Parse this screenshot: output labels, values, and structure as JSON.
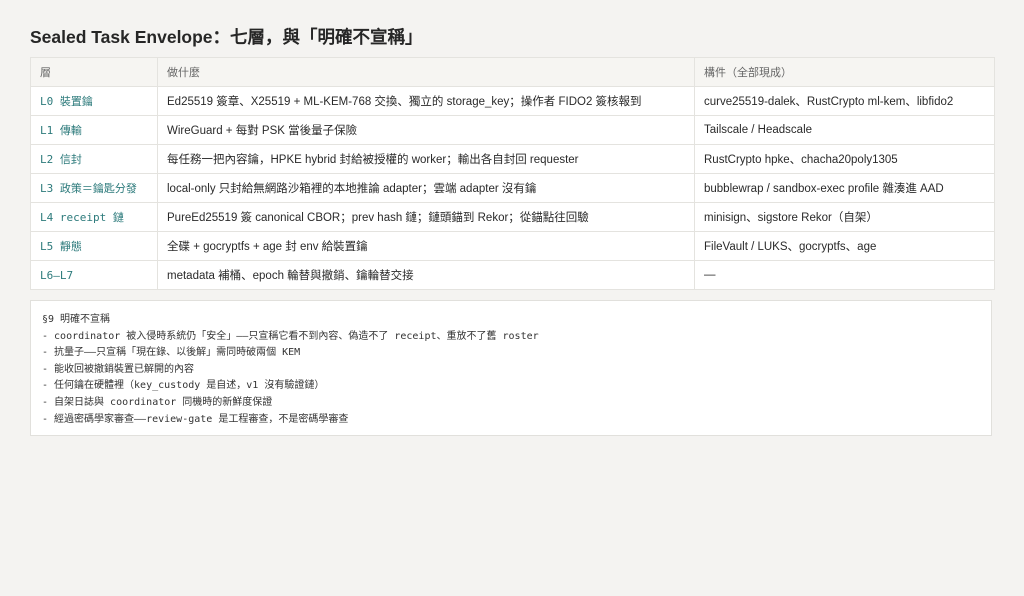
{
  "title": "Sealed Task Envelope：七層，與「明確不宣稱」",
  "table": {
    "headers": [
      "層",
      "做什麼",
      "構件（全部現成）"
    ],
    "rows": [
      {
        "layer": "L0 裝置鑰",
        "what": "Ed25519 簽章、X25519 + ML-KEM-768 交換、獨立的 storage_key；操作者 FIDO2 簽核報到",
        "components": "curve25519-dalek、RustCrypto ml-kem、libfido2"
      },
      {
        "layer": "L1 傳輸",
        "what": "WireGuard + 每對 PSK 當後量子保險",
        "components": "Tailscale / Headscale"
      },
      {
        "layer": "L2 信封",
        "what": "每任務一把內容鑰，HPKE hybrid 封給被授權的 worker；輸出各自封回 requester",
        "components": "RustCrypto hpke、chacha20poly1305"
      },
      {
        "layer": "L3 政策＝鑰匙分發",
        "what": "local-only 只封給無網路沙箱裡的本地推論 adapter；雲端 adapter 沒有鑰",
        "components": "bubblewrap / sandbox-exec profile 雜湊進 AAD"
      },
      {
        "layer": "L4 receipt 鏈",
        "what": "PureEd25519 簽 canonical CBOR；prev hash 鏈；鏈頭錨到 Rekor；從錨點往回驗",
        "components": "minisign、sigstore Rekor（自架）"
      },
      {
        "layer": "L5 靜態",
        "what": "全碟 + gocryptfs + age 封 env 給裝置鑰",
        "components": "FileVault / LUKS、gocryptfs、age"
      },
      {
        "layer": "L6–L7",
        "what": "metadata 補桶、epoch 輪替與撤銷、鑰輪替交接",
        "components": "—"
      }
    ]
  },
  "notes": {
    "heading": "§9 明確不宣稱",
    "lines": [
      "- coordinator 被入侵時系統仍「安全」——只宣稱它看不到內容、偽造不了 receipt、重放不了舊 roster",
      "- 抗量子——只宣稱「現在錄、以後解」需同時破兩個 KEM",
      "- 能收回被撤銷裝置已解開的內容",
      "- 任何鑰在硬體裡（key_custody 是自述，v1 沒有驗證鏈）",
      "- 自架日誌與 coordinator 同機時的新鮮度保證",
      "- 經過密碼學家審查——review-gate 是工程審查，不是密碼學審查"
    ]
  }
}
